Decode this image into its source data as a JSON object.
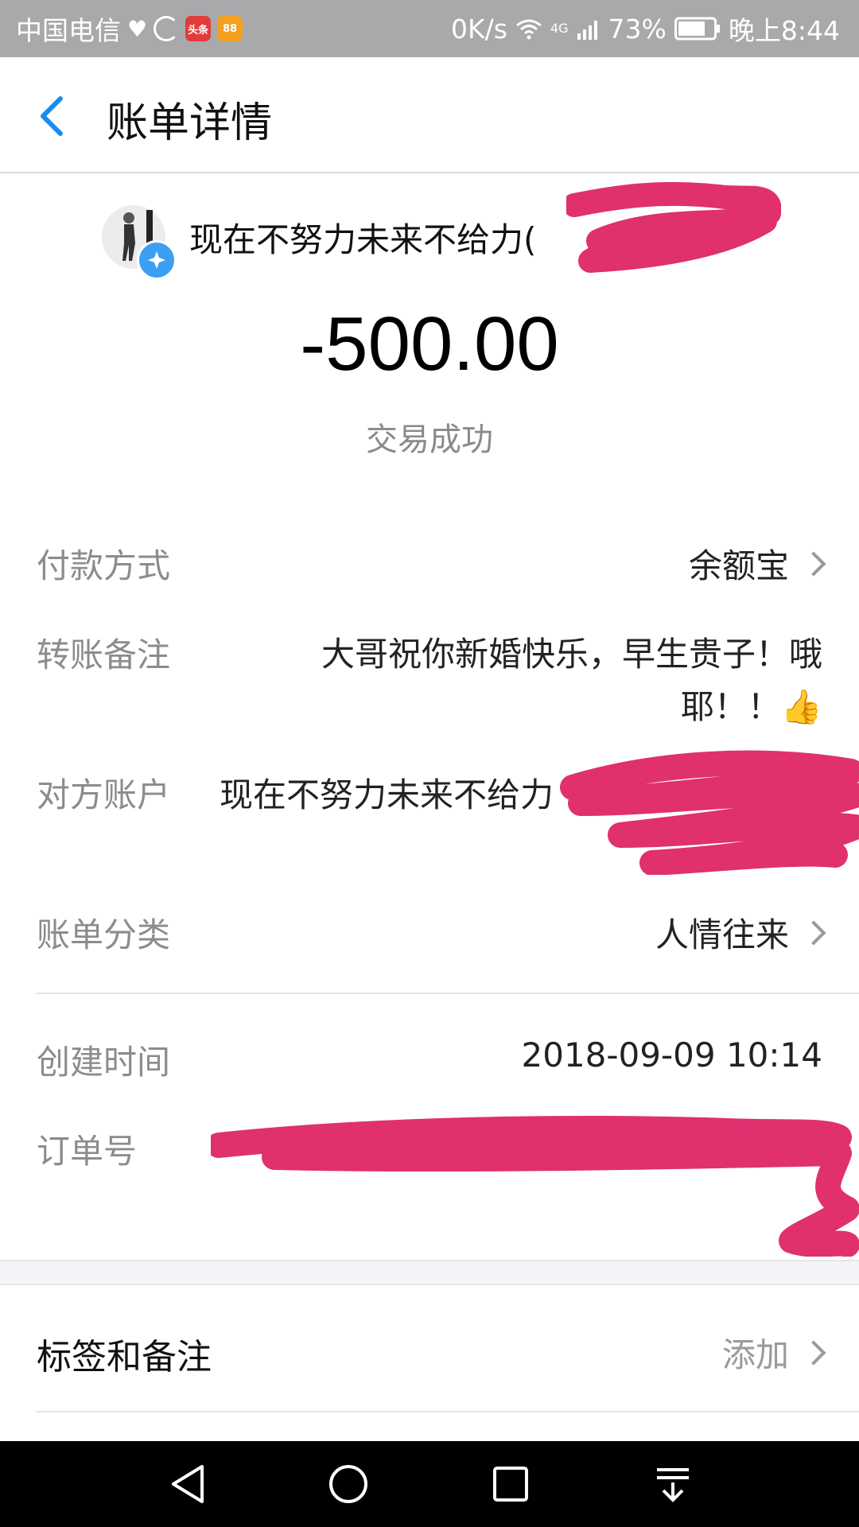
{
  "status_bar": {
    "carrier": "中国电信",
    "app_badge_1": "头条",
    "app_badge_2": "88",
    "net_speed": "0K/s",
    "network": "4G",
    "battery": "73%",
    "time": "晚上8:44"
  },
  "header": {
    "title": "账单详情"
  },
  "summary": {
    "payee_name": "现在不努力未来不给力(",
    "amount": "-500.00",
    "status": "交易成功"
  },
  "details": {
    "payment_method_label": "付款方式",
    "payment_method_value": "余额宝",
    "remark_label": "转账备注",
    "remark_value": "大哥祝你新婚快乐，早生贵子！哦耶！！👍",
    "counterparty_label": "对方账户",
    "counterparty_value": "现在不努力未来不给力",
    "category_label": "账单分类",
    "category_value": "人情往来",
    "created_label": "创建时间",
    "created_value": "2018-09-09 10:14",
    "order_label": "订单号"
  },
  "tags": {
    "label": "标签和备注",
    "action": "添加"
  },
  "colors": {
    "accent": "#1a8cf0",
    "redaction": "#e0306e",
    "status_bar": "#a9a9ac"
  },
  "icons": [
    "back-arrow-icon",
    "verified-icon",
    "chevron-right-icon",
    "wifi-icon",
    "signal-icon",
    "battery-icon",
    "nav-back-icon",
    "nav-home-icon",
    "nav-recents-icon",
    "nav-notifications-icon"
  ]
}
